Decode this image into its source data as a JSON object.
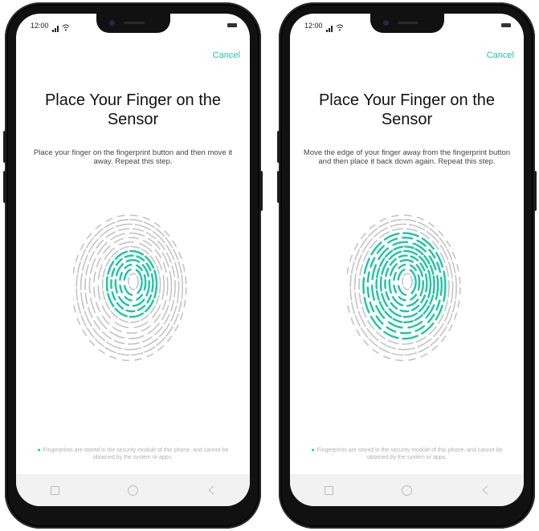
{
  "accent_color": "#1dc5a1",
  "screens": [
    {
      "status_time": "12:00",
      "cancel_label": "Cancel",
      "title": "Place Your Finger on the Sensor",
      "description": "Place your finger on the fingerprint button and then move it away. Repeat this step.",
      "footer_note": "Fingerprints are stored in the security module of this phone, and cannot be obtained by the system or apps.",
      "fingerprint_progress": 0.25,
      "icons": [
        "signal-icon",
        "wifi-icon",
        "battery-icon",
        "shield-icon",
        "recents-icon",
        "home-icon",
        "back-icon"
      ]
    },
    {
      "status_time": "12:00",
      "cancel_label": "Cancel",
      "title": "Place Your Finger on the Sensor",
      "description": "Move the edge of your finger away from the fingerprint button and then place it back down again. Repeat this step.",
      "footer_note": "Fingerprints are stored in the security module of this phone, and cannot be obtained by the system or apps.",
      "fingerprint_progress": 0.6,
      "icons": [
        "signal-icon",
        "wifi-icon",
        "battery-icon",
        "shield-icon",
        "recents-icon",
        "home-icon",
        "back-icon"
      ]
    }
  ]
}
